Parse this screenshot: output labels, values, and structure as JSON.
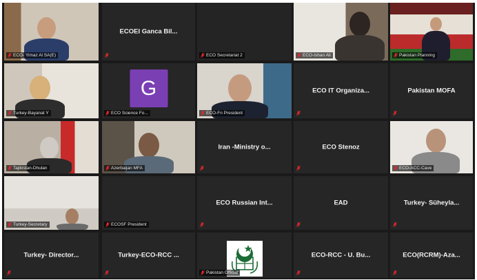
{
  "meeting": {
    "tiles": [
      {
        "id": "r1c1",
        "type": "video",
        "label": "ECO- Yimaz Al SA(E)",
        "display": ""
      },
      {
        "id": "r1c2",
        "type": "name",
        "label": "",
        "display": "ECOEI Ganca Bil..."
      },
      {
        "id": "r1c3",
        "type": "video",
        "label": "ECO Secretariat 2",
        "display": "",
        "active": true
      },
      {
        "id": "r1c4",
        "type": "video",
        "label": "ECO-Ishan Ali",
        "display": ""
      },
      {
        "id": "r1c5",
        "type": "video",
        "label": "Pakistan Planning",
        "display": ""
      },
      {
        "id": "r2c1",
        "type": "video",
        "label": "Turkey-Bayanat Y",
        "display": ""
      },
      {
        "id": "r2c2",
        "type": "avatar",
        "label": "ECO Science Fo...",
        "display": "",
        "avatar": "G"
      },
      {
        "id": "r2c3",
        "type": "video",
        "label": "ECO-Fn President",
        "display": ""
      },
      {
        "id": "r2c4",
        "type": "name",
        "label": "",
        "display": "ECO IT Organiza..."
      },
      {
        "id": "r2c5",
        "type": "name",
        "label": "",
        "display": "Pakistan MOFA"
      },
      {
        "id": "r3c1",
        "type": "video",
        "label": "Tajikistan-Dhulan",
        "display": ""
      },
      {
        "id": "r3c2",
        "type": "video",
        "label": "Azerbaijan MFA",
        "display": ""
      },
      {
        "id": "r3c3",
        "type": "name",
        "label": "",
        "display": "Iran -Ministry o..."
      },
      {
        "id": "r3c4",
        "type": "name",
        "label": "",
        "display": "ECO Stenoz"
      },
      {
        "id": "r3c5",
        "type": "video",
        "label": "ECO-ACC-Cave",
        "display": ""
      },
      {
        "id": "r4c1",
        "type": "video",
        "label": "Turkey-Secretary",
        "display": ""
      },
      {
        "id": "r4c2",
        "type": "name-tag",
        "label": "ECOSF President",
        "display": ""
      },
      {
        "id": "r4c3",
        "type": "name",
        "label": "",
        "display": "ECO Russian Int..."
      },
      {
        "id": "r4c4",
        "type": "name",
        "label": "",
        "display": "EAD"
      },
      {
        "id": "r4c5",
        "type": "name",
        "label": "",
        "display": "Turkey- Süheyla..."
      },
      {
        "id": "r5c1",
        "type": "name",
        "label": "",
        "display": "Turkey- Director..."
      },
      {
        "id": "r5c2",
        "type": "name",
        "label": "",
        "display": "Turkey-ECO-RCC ..."
      },
      {
        "id": "r5c3",
        "type": "flag",
        "label": "Pakistan Official",
        "display": ""
      },
      {
        "id": "r5c4",
        "type": "name",
        "label": "",
        "display": "ECO-RCC - U. Bu..."
      },
      {
        "id": "r5c5",
        "type": "name",
        "label": "",
        "display": "ECO(RCRM)-Aza..."
      }
    ]
  },
  "colors": {
    "grid_bg": "#1a1a1a",
    "tile_bg": "#262626",
    "active_border": "#c8d23a",
    "mute_red": "#e0282e",
    "avatar_purple": "#7b3fb4"
  },
  "icons": {
    "mute": "microphone-muted-icon"
  }
}
